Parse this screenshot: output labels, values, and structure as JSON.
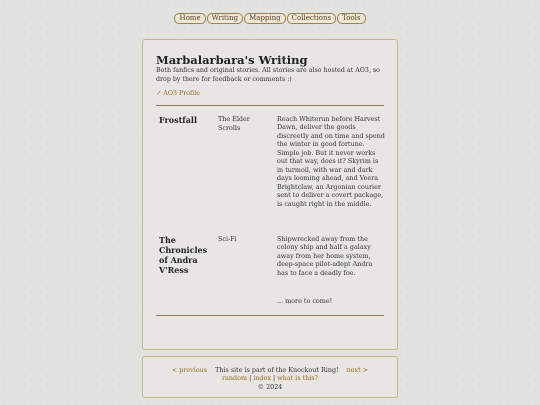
{
  "nav": [
    "Home",
    "Writing",
    "Mapping",
    "Collections",
    "Tools"
  ],
  "page": {
    "title": "Marbalarbara's Writing",
    "intro": "Both fanfics and original stories. All stories are also hosted at AO3, so drop by there for feedback or comments :)",
    "profile_icon": "external-arrow-icon",
    "profile_link": "AO3 Profile"
  },
  "stories": [
    {
      "title": "Frostfall",
      "genre": "The Elder Scrolls",
      "description": "Reach Whiterun before Harvest Dawn, deliver the goods discreetly and on time and spend the winter in good fortune. Simple job. But it never works out that way, does it? Skyrim is in turmoil, with war and dark days looming ahead, and Veera Brightclaw, an Argonian courier sent to deliver a covert package, is caught right in the middle."
    },
    {
      "title": "The Chronicles of Andra V'Ress",
      "genre": "Sci-Fi",
      "description": "Shipwrecked away from the colony ship and half a galaxy away from her home system, deep-space pilot-adept Andra has to face a deadly foe."
    }
  ],
  "more": "... more to come!",
  "footer": {
    "prev": "< previous",
    "ring_text": "This site is part of the Knockout Ring!",
    "next": "next >",
    "random": "random",
    "sep": "|",
    "index": "index",
    "whatis": "what is this?",
    "copyright": "© 2024"
  }
}
